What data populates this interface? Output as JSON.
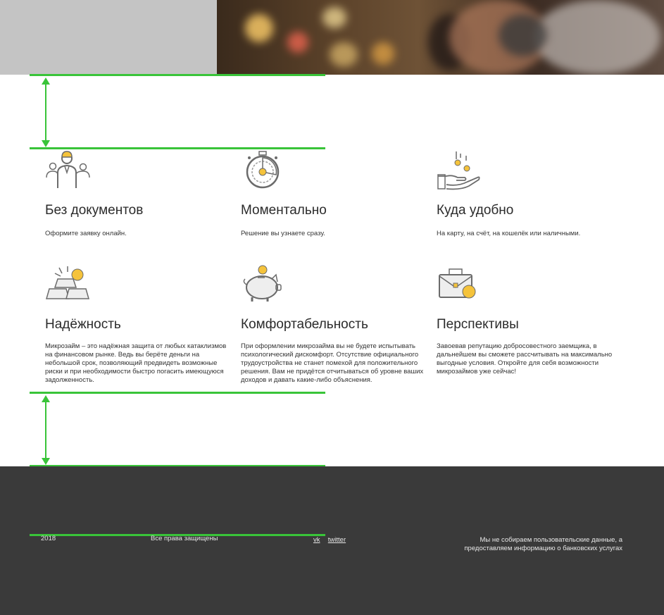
{
  "features": [
    {
      "icon": "business-people-icon",
      "title": "Без документов",
      "text": "Оформите заявку онлайн."
    },
    {
      "icon": "stopwatch-icon",
      "title": "Моментально",
      "text": "Решение вы узнаете сразу."
    },
    {
      "icon": "hand-coins-icon",
      "title": "Куда удобно",
      "text": "На карту, на счёт, на кошелёк или наличными."
    },
    {
      "icon": "gold-bars-icon",
      "title": "Надёжность",
      "text": "Микрозайм – это надёжная защита от любых катаклизмов на финансовом рынке. Ведь вы берёте деньги на небольшой срок, позволяющий предвидеть возможные риски и при необходимости быстро погасить имеющуюся задолженность."
    },
    {
      "icon": "piggy-bank-icon",
      "title": "Комфортабельность",
      "text": "При оформлении микрозайма вы не будете испытывать психологический дискомфорт. Отсутствие официального трудоустройства не станет помехой для положительного решения. Вам не придётся отчитываться об  уровне ваших доходов и давать какие-либо объяснения."
    },
    {
      "icon": "briefcase-coin-icon",
      "title": "Перспективы",
      "text": "Завоевав репутацию добросовестного заемщика, в дальнейшем вы сможете рассчитывать на максимально выгодные условия. Откройте для себя возможности микрозаймов уже сейчас!"
    }
  ],
  "footer": {
    "year": "2018",
    "rights": "Все права защищены",
    "social": {
      "vk": "vk",
      "twitter": "twitter"
    },
    "disclaimer_line1": "Мы не собираем пользовательские данные, а",
    "disclaimer_line2": "предоставляем информацию о банковских услугах"
  },
  "colors": {
    "accent_guides": "#39c439",
    "footer_bg": "#3a3a3a",
    "icon_yellow": "#f5c33b",
    "icon_gray": "#6b6b6b"
  }
}
